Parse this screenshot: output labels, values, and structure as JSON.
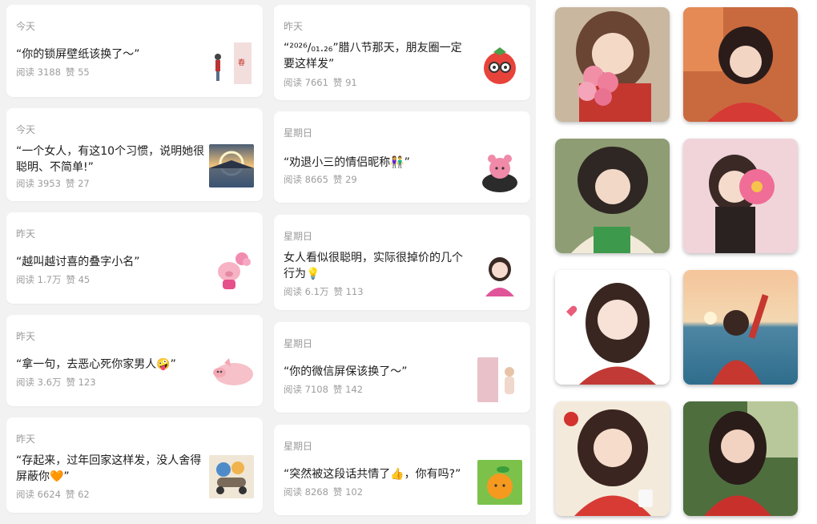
{
  "feed": {
    "left": [
      {
        "day": "今天",
        "title": "“你的锁屏壁纸该换了～”",
        "read": "阅读 3188",
        "like": "赞 55",
        "thumb_icon": "couple-sketch-icon"
      },
      {
        "day": "今天",
        "title": "“一个女人，有这10个习惯，说明她很聪明、不简单!”",
        "read": "阅读 3953",
        "like": "赞 27",
        "thumb_icon": "sunset-mountain-image"
      },
      {
        "day": "昨天",
        "title": "“越叫越讨喜的叠字小名”",
        "read": "阅读 1.7万",
        "like": "赞 45",
        "thumb_icon": "pig-flower-sticker"
      },
      {
        "day": "昨天",
        "title": "“拿一句，去恶心死你家男人🤪”",
        "read": "阅读 3.6万",
        "like": "赞 123",
        "thumb_icon": "pig-sticker"
      },
      {
        "day": "昨天",
        "title": "“存起来，过年回家这样发，没人舍得屏蔽你🧡”",
        "read": "阅读 6624",
        "like": "赞 62",
        "thumb_icon": "cartoon-riders-sticker"
      }
    ],
    "right": [
      {
        "day": "昨天",
        "title": "“²⁰²⁶/₀₁.₂₆”腊八节那天，朋友圈一定要这样发”",
        "read": "阅读 7661",
        "like": "赞 91",
        "thumb_icon": "tomato-glasses-sticker"
      },
      {
        "day": "星期日",
        "title": "“劝退小三的情侣昵称👫”",
        "read": "阅读 8665",
        "like": "赞 29",
        "thumb_icon": "pink-bear-sticker"
      },
      {
        "day": "星期日",
        "title": "女人看似很聪明，实际很掉价的几个行为💡",
        "read": "阅读 6.1万",
        "like": "赞 113",
        "thumb_icon": "girl-illustration"
      },
      {
        "day": "星期日",
        "title": "“你的微信屏保该换了～”",
        "read": "阅读 7108",
        "like": "赞 142",
        "thumb_icon": "pink-wallpaper-image"
      },
      {
        "day": "星期日",
        "title": "“突然被这段话共情了👍，你有吗?”",
        "read": "阅读 8268",
        "like": "赞 102",
        "thumb_icon": "orange-fruit-sticker"
      }
    ]
  },
  "gallery": [
    {
      "name": "girl-roses-photo"
    },
    {
      "name": "girl-red-dress-photo"
    },
    {
      "name": "girl-green-book-photo"
    },
    {
      "name": "girl-pink-flower-photo"
    },
    {
      "name": "girl-heart-photo"
    },
    {
      "name": "girl-sea-wave-photo"
    },
    {
      "name": "girl-coffee-photo"
    },
    {
      "name": "girl-leaves-photo"
    }
  ],
  "colors": {
    "page_bg": "#f2f2f2",
    "card_bg": "#ffffff",
    "meta_text": "#9d9d9d",
    "title_text": "#1c1c1c"
  }
}
